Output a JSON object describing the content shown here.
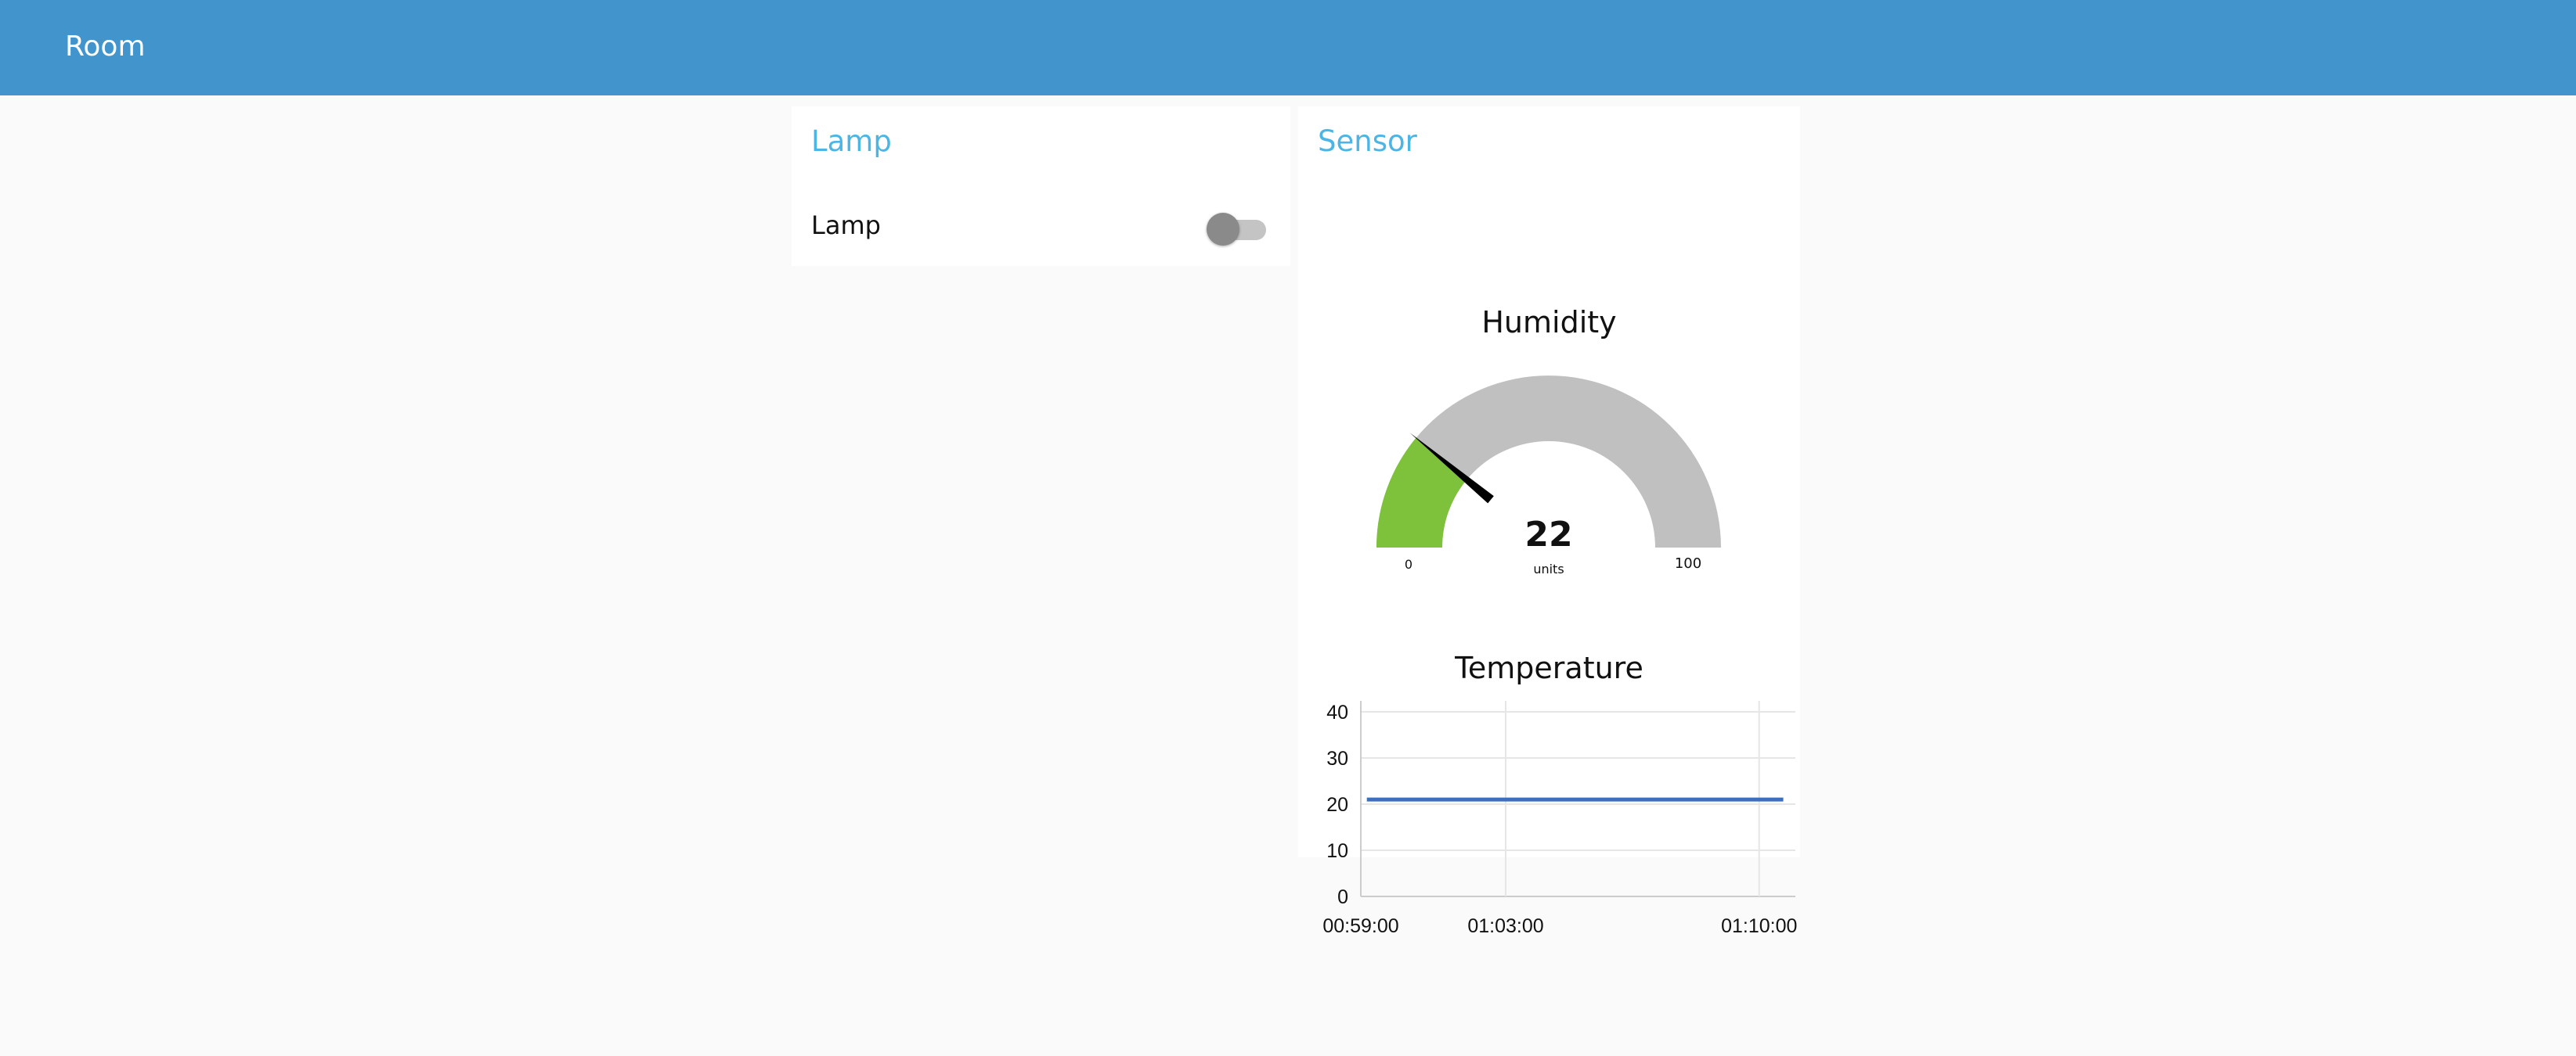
{
  "header": {
    "title": "Room"
  },
  "lamp_group": {
    "title": "Lamp",
    "switch_label": "Lamp",
    "switch_state": "off",
    "colors": {
      "track": "#c4c4c4",
      "knob": "#8a8a8a"
    }
  },
  "sensor_group": {
    "title": "Sensor",
    "humidity_gauge": {
      "title": "Humidity",
      "value": 22,
      "units": "units",
      "min": 0,
      "max": 100,
      "min_label": "0",
      "max_label": "100",
      "value_label": "22",
      "colors": {
        "fill": "#7dc23a",
        "background": "#c0c0c0",
        "needle": "#000000"
      }
    },
    "temperature_chart": {
      "title": "Temperature"
    }
  },
  "chart_data": {
    "type": "line",
    "title": "Temperature",
    "xlabel": "",
    "ylabel": "",
    "ylim": [
      0,
      40
    ],
    "yticks": [
      0,
      10,
      20,
      30,
      40
    ],
    "ytick_labels": [
      "0",
      "10",
      "20",
      "30",
      "40"
    ],
    "x_axis_range": [
      "00:59:00",
      "01:11:00"
    ],
    "xtick_labels": [
      "00:59:00",
      "01:03:00",
      "01:10:00"
    ],
    "xtick_values": [
      "00:59:00",
      "01:03:00",
      "01:10:00"
    ],
    "grid": true,
    "series": [
      {
        "color": "#3a6fc4",
        "x": [
          "00:59:10",
          "01:10:40"
        ],
        "y": [
          21,
          21
        ]
      }
    ]
  },
  "colors": {
    "header_bg": "#4194cc",
    "group_title": "#4bb5e5",
    "page_bg": "#fafafa",
    "card_bg": "#ffffff"
  }
}
